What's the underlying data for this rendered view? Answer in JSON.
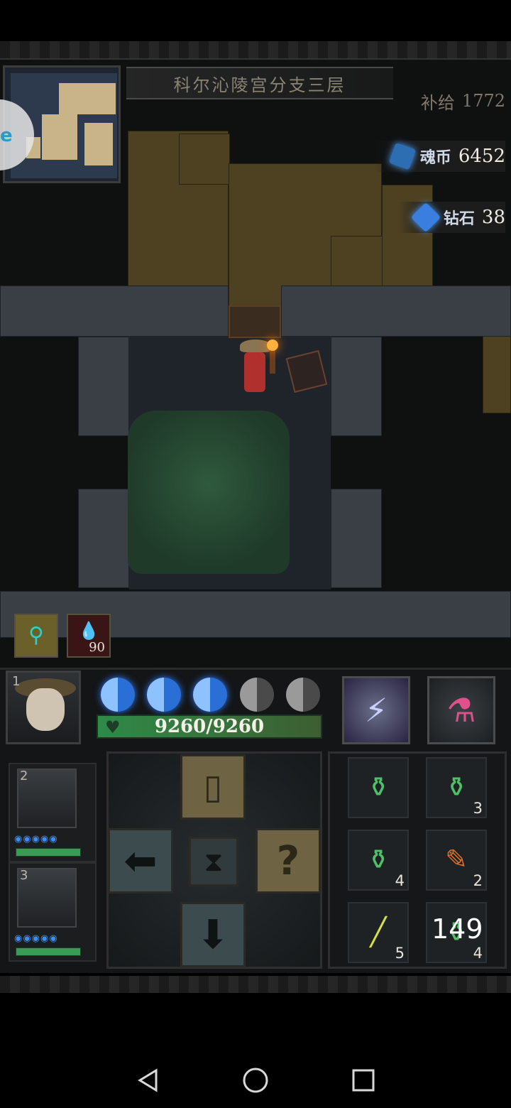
{
  "floor": {
    "title": "科尔沁陵宫分支三层"
  },
  "resources": {
    "supply": {
      "label": "补给",
      "value": "1772"
    },
    "soul_coin": {
      "label": "魂币",
      "value": "6452",
      "icon": "soul-coin-icon"
    },
    "diamond": {
      "label": "钻石",
      "value": "38",
      "icon": "diamond-icon"
    }
  },
  "quick_slots": [
    {
      "icon": "map-scroll-icon"
    },
    {
      "icon": "blood-drops-icon",
      "count": "90"
    }
  ],
  "hero": {
    "slot": "1",
    "hp_text": "9260/9260",
    "energy_total": 5,
    "energy_filled": 3
  },
  "skills": [
    {
      "icon": "lightning-shackle-icon"
    },
    {
      "icon": "pink-potion-flask-icon"
    }
  ],
  "party": [
    {
      "slot": "2",
      "energy": "◉◉◉◉◉"
    },
    {
      "slot": "3",
      "energy": "◉◉◉◉◉"
    }
  ],
  "controls": {
    "door": "door-icon",
    "left": "arrow-left-icon",
    "wait": "hourglass-icon",
    "help": "question-icon",
    "down": "arrow-down-icon",
    "glyphs": {
      "door": "▯",
      "left": "⬅",
      "wait": "⧗",
      "help": "?",
      "down": "⬇"
    }
  },
  "inventory": [
    {
      "icon": "green-potion-bottle-icon",
      "count": ""
    },
    {
      "icon": "green-potion-bottle-icon",
      "count": "3"
    },
    {
      "icon": "green-potion-bottle-icon",
      "count": "4"
    },
    {
      "icon": "fire-feather-icon",
      "count": "2"
    },
    {
      "icon": "yellow-vial-icon",
      "count": "5"
    },
    {
      "icon": "green-potion-bottle-icon",
      "count": "4",
      "overlay": "149"
    }
  ],
  "colors": {
    "hp_bar": "#2f8a48",
    "energy_blue": "#2a6fd6",
    "sand": "#4e4122",
    "stone": "#3a3e45"
  }
}
